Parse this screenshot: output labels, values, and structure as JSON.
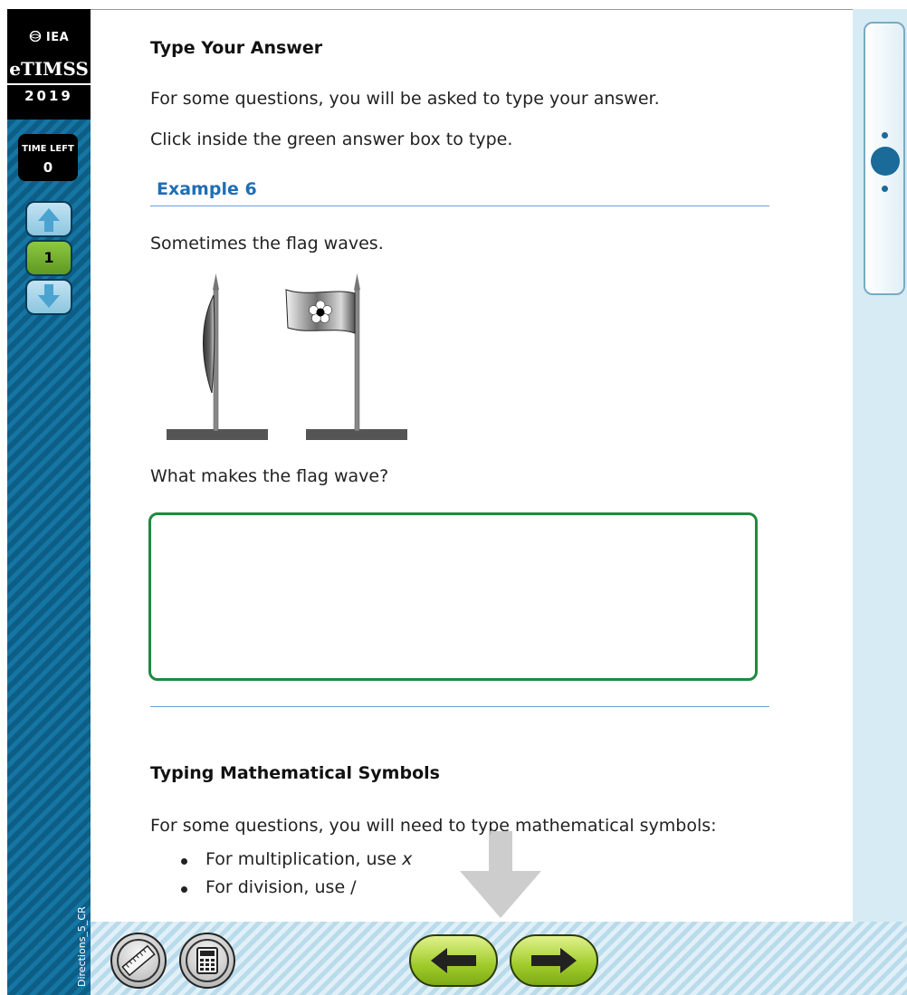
{
  "sidebar": {
    "logo": {
      "org": "IEA",
      "brand": "eTIMSS",
      "year": "2019"
    },
    "time_left_label": "TIME LEFT",
    "time_left_value": "0",
    "current_item": "1",
    "screen_id": "Directions_5_CR"
  },
  "content": {
    "title": "Type Your Answer",
    "intro_1": "For some questions, you will be asked to type your answer.",
    "intro_2": "Click inside the green answer box to type.",
    "example_heading": "Example 6",
    "example_text": "Sometimes the flag waves.",
    "question": "What makes the flag wave?",
    "answer_value": "",
    "math_title": "Typing Mathematical Symbols",
    "math_intro": "For some questions, you will need to type mathematical symbols:",
    "bullets": [
      {
        "text": "For multiplication, use ",
        "symbol": "x"
      },
      {
        "text": "For division, use /",
        "symbol": ""
      }
    ]
  },
  "toolbar": {
    "tools": [
      "ruler-icon",
      "calculator-icon"
    ],
    "nav": [
      "back-arrow-icon",
      "next-arrow-icon"
    ]
  },
  "colors": {
    "sidebar_blue": "#0d5e86",
    "heading_blue": "#1f6eb5",
    "answer_border_green": "#1e8a3e",
    "nav_button_green": "#9fcb2a",
    "panel_light_blue": "#d6ebf4"
  }
}
